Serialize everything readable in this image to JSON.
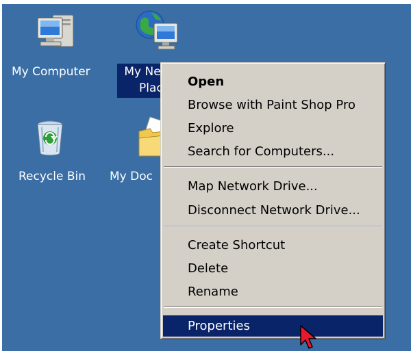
{
  "desktop": {
    "icons": [
      {
        "name": "my-computer",
        "label": "My Computer"
      },
      {
        "name": "my-network-places",
        "label_line1": "My Ne",
        "label_line2": "Plac"
      },
      {
        "name": "recycle-bin",
        "label": "Recycle Bin"
      },
      {
        "name": "my-documents",
        "label": "My Doc"
      }
    ]
  },
  "context_menu": {
    "items": [
      {
        "label": "Open"
      },
      {
        "label": "Browse with Paint Shop Pro"
      },
      {
        "label": "Explore"
      },
      {
        "label": "Search for Computers..."
      },
      {
        "label": "Map Network Drive..."
      },
      {
        "label": "Disconnect Network Drive..."
      },
      {
        "label": "Create Shortcut"
      },
      {
        "label": "Delete"
      },
      {
        "label": "Rename"
      },
      {
        "label": "Properties"
      }
    ],
    "default_item": "Open",
    "highlighted_item": "Properties"
  },
  "colors": {
    "desktop": "#3a6ea5",
    "selection": "#0a246a",
    "menu_face": "#d4d0c8",
    "cursor": "#e8192c"
  }
}
